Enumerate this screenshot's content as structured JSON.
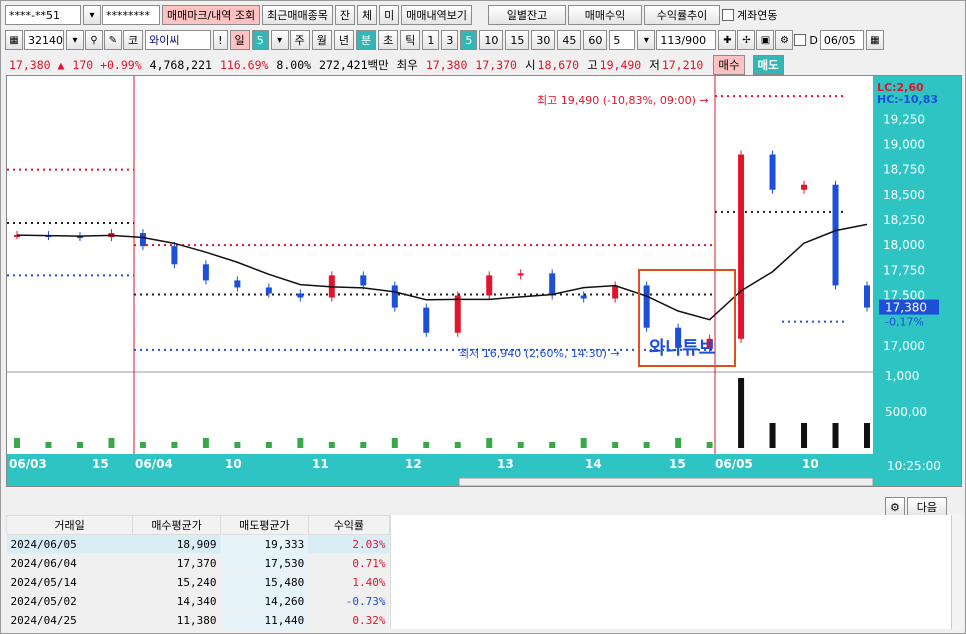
{
  "toolbar1": {
    "account": "****-**51",
    "password": "********",
    "trade_mark": "매매마크/내역 조회",
    "recent": "최근매매종목",
    "chk_jan": "잔",
    "chk_che": "체",
    "chk_mi": "미",
    "history": "매매내역보기",
    "daily_balance": "일별잔고",
    "trade_profit": "매매수익",
    "profit_trend": "수익률추이",
    "account_link": "계좌연동"
  },
  "toolbar2": {
    "code": "32140",
    "market": "코",
    "name": "와이씨",
    "excl": "!",
    "period": "일",
    "period_n": "5",
    "tf": [
      "주",
      "월",
      "년",
      "분",
      "초",
      "틱"
    ],
    "active_tf": "분",
    "mins": [
      "1",
      "3",
      "5",
      "10",
      "15",
      "30",
      "45",
      "60"
    ],
    "active_min": "5",
    "sel": "5",
    "count": "113/900",
    "date_chk": "D",
    "date": "06/05"
  },
  "quote": {
    "price": "17,380 ▲",
    "change": "170 +0.99%",
    "volume": "4,768,221",
    "vol_ratio": "116.69%",
    "turnover": "8.00%",
    "amount": "272,421백만",
    "best": "최우",
    "ask": "17,380",
    "bid": "17,370",
    "open_l": "시",
    "open": "18,670",
    "high_l": "고",
    "high": "19,490",
    "low_l": "저",
    "low": "17,210",
    "buy": "매수",
    "sell": "매도"
  },
  "chart": {
    "high_label": "최고 19,490 (-10,83%, 09:00) →",
    "low_label": "최저 16,940 (2,60%, 14:30) →",
    "lc": "LC:2,60",
    "hc": "HC:-10,83",
    "cur_price": "17,380",
    "cur_pct": "-0,17%",
    "watermark": "와나튜브",
    "price_ticks": [
      "19,250",
      "19,000",
      "18,750",
      "18,500",
      "18,250",
      "18,000",
      "17,750",
      "17,500",
      "17,000"
    ],
    "vol_ticks": [
      "1,000",
      "500,00"
    ],
    "time_label": "10:25:00",
    "x_labels": [
      "06/03",
      "15",
      "06/04",
      "10",
      "11",
      "12",
      "13",
      "14",
      "15",
      "06/05",
      "10"
    ]
  },
  "bottom": {
    "settings": "⚙",
    "next": "다음"
  },
  "table": {
    "headers": [
      "거래일",
      "매수평균가",
      "매도평균가",
      "수익률"
    ],
    "rows": [
      [
        "2024/06/05",
        "18,909",
        "19,333",
        "2.03%"
      ],
      [
        "2024/06/04",
        "17,370",
        "17,530",
        "0.71%"
      ],
      [
        "2024/05/14",
        "15,240",
        "15,480",
        "1.40%"
      ],
      [
        "2024/05/02",
        "14,340",
        "14,260",
        "-0.73%"
      ],
      [
        "2024/04/25",
        "11,380",
        "11,440",
        "0.32%"
      ]
    ]
  },
  "chart_data": {
    "type": "candlestick",
    "title": "",
    "y_range": [
      16800,
      19600
    ],
    "price_line": [
      [
        "06/03 09:00",
        18100
      ],
      [
        "06/03 09:10",
        18090
      ],
      [
        "06/03 09:20",
        18080
      ],
      [
        "06/03 09:30",
        18120
      ],
      [
        "06/03 10:00",
        17990
      ],
      [
        "06/03 10:30",
        17810
      ],
      [
        "06/03 11:00",
        17650
      ],
      [
        "06/03 12:00",
        17580
      ],
      [
        "06/03 13:00",
        17520
      ],
      [
        "06/03 14:00",
        17480
      ],
      [
        "06/03 15:00",
        17700
      ],
      [
        "06/04 09:00",
        17600
      ],
      [
        "06/04 09:10",
        17380
      ],
      [
        "06/04 09:20",
        17130
      ],
      [
        "06/04 09:30",
        17500
      ],
      [
        "06/04 10:00",
        17700
      ],
      [
        "06/04 10:30",
        17720
      ],
      [
        "06/04 11:00",
        17500
      ],
      [
        "06/04 12:00",
        17470
      ],
      [
        "06/04 13:00",
        17600
      ],
      [
        "06/04 14:00",
        17180
      ],
      [
        "06/04 14:30",
        16980
      ],
      [
        "06/04 15:00",
        17070
      ],
      [
        "06/05 09:00",
        18900
      ],
      [
        "06/05 09:10",
        18550
      ],
      [
        "06/05 09:30",
        18600
      ],
      [
        "06/05 10:00",
        17600
      ],
      [
        "06/05 10:25",
        17380
      ]
    ]
  }
}
